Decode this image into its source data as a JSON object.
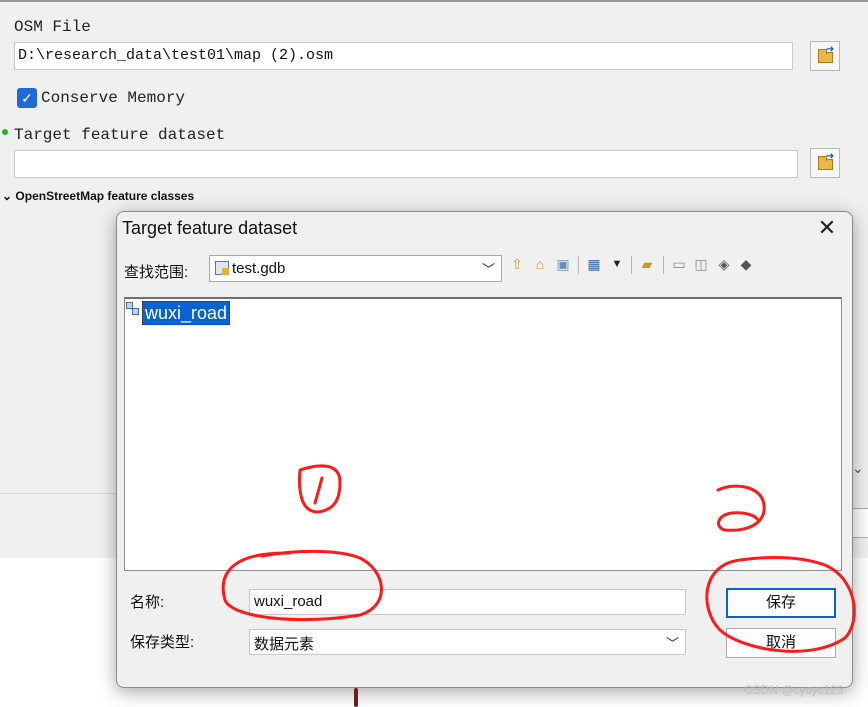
{
  "tool": {
    "osm_file_label": "OSM File",
    "osm_file_value": "D:\\research_data\\test01\\map (2).osm",
    "conserve_memory_label": "Conserve Memory",
    "conserve_memory_checked": true,
    "target_dataset_label": "Target feature dataset",
    "target_dataset_value": "",
    "section_label": "OpenStreetMap feature classes"
  },
  "dialog": {
    "title": "Target feature dataset",
    "close_glyph": "✕",
    "look_in_label": "查找范围:",
    "look_in_value": "test.gdb",
    "items": [
      {
        "label": "wuxi_road",
        "selected": true
      }
    ],
    "name_label": "名称:",
    "name_value": "wuxi_road",
    "type_label": "保存类型:",
    "type_value": "数据元素",
    "save_button": "保存",
    "cancel_button": "取消"
  },
  "icons": {
    "up_level": "up-folder-icon",
    "home": "home-folder-icon",
    "connect": "connect-folder-icon",
    "view": "grid-view-icon",
    "new_folder": "new-folder-icon",
    "new_items": [
      "new-file-geodatabase-icon",
      "new-personal-geodatabase-icon",
      "new-toolbox-icon",
      "new-database-connection-icon"
    ]
  },
  "annotations": {
    "marker_1": "1",
    "marker_2": "2",
    "color": "#ff1a1a"
  },
  "watermark": "CSDN @cycyc123",
  "colors": {
    "accent": "#1e6bd6",
    "selection": "#0b63cf",
    "required_dot": "#25b825"
  }
}
